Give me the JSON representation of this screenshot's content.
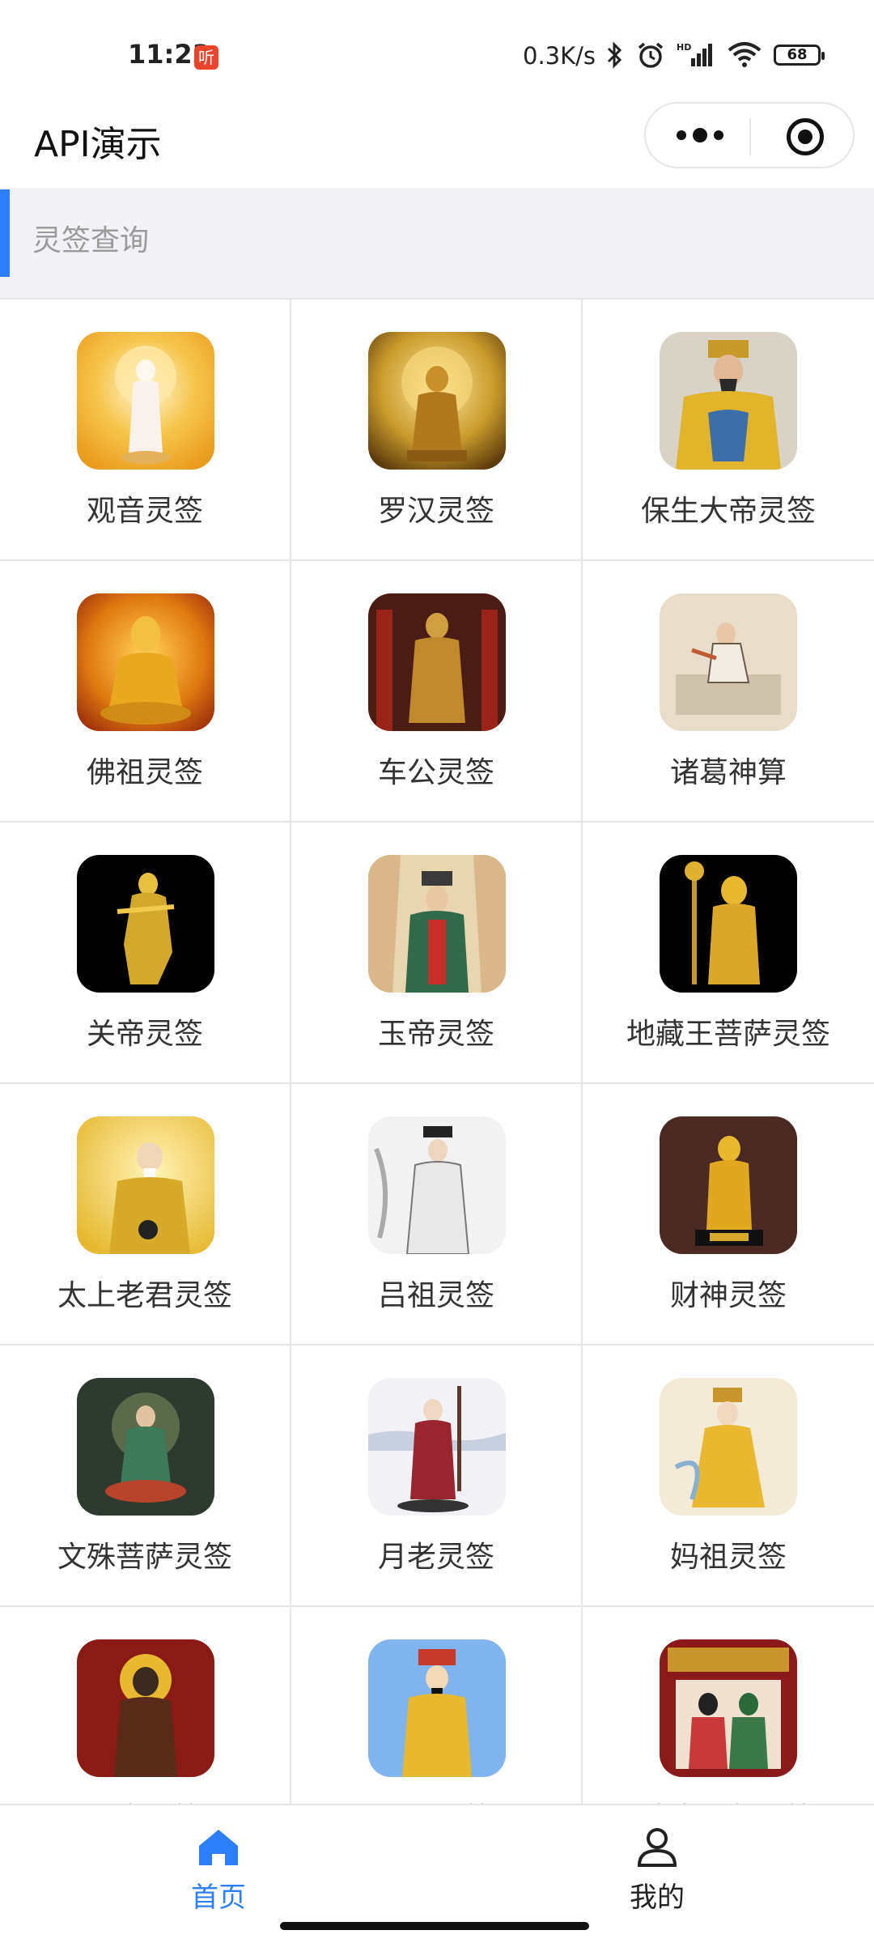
{
  "status_bar": {
    "time": "11:23",
    "badge": "听",
    "net_speed": "0.3K/s",
    "battery": "68",
    "icons": [
      "bluetooth-icon",
      "alarm-icon",
      "signal-icon",
      "wifi-icon",
      "battery-icon"
    ]
  },
  "nav": {
    "title": "API演示",
    "more_icon": "more-dots-icon",
    "close_icon": "target-close-icon"
  },
  "section": {
    "title": "灵签查询",
    "accent": "#2d7ff9"
  },
  "items": [
    {
      "label": "观音灵签"
    },
    {
      "label": "罗汉灵签"
    },
    {
      "label": "保生大帝灵签"
    },
    {
      "label": "佛祖灵签"
    },
    {
      "label": "车公灵签"
    },
    {
      "label": "诸葛神算"
    },
    {
      "label": "关帝灵签"
    },
    {
      "label": "玉帝灵签"
    },
    {
      "label": "地藏王菩萨灵签"
    },
    {
      "label": "太上老君灵签"
    },
    {
      "label": "吕祖灵签"
    },
    {
      "label": "财神灵签"
    },
    {
      "label": "文殊菩萨灵签"
    },
    {
      "label": "月老灵签"
    },
    {
      "label": "妈祖灵签"
    },
    {
      "label": "北帝灵签"
    },
    {
      "label": "天公灵签"
    },
    {
      "label": "清水祖师灵签"
    }
  ],
  "tabbar": {
    "home": {
      "label": "首页",
      "icon": "home-icon",
      "color": "#2d7ff9"
    },
    "mine": {
      "label": "我的",
      "icon": "user-icon",
      "color": "#222222"
    }
  }
}
